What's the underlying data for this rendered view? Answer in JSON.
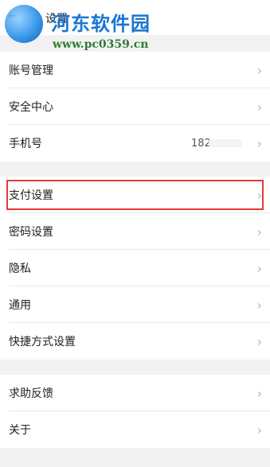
{
  "header": {
    "title": "设置"
  },
  "watermark": {
    "site_name": "河东软件园",
    "url": "www.pc0359.cn"
  },
  "groups": [
    {
      "items": [
        {
          "label": "账号管理"
        },
        {
          "label": "安全中心"
        },
        {
          "label": "手机号",
          "value": "182"
        }
      ]
    },
    {
      "items": [
        {
          "label": "支付设置"
        },
        {
          "label": "密码设置"
        },
        {
          "label": "隐私"
        },
        {
          "label": "通用"
        },
        {
          "label": "快捷方式设置"
        }
      ]
    },
    {
      "items": [
        {
          "label": "求助反馈"
        },
        {
          "label": "关于"
        }
      ]
    }
  ],
  "colors": {
    "highlight": "#e53935",
    "background": "#f2f2f2"
  },
  "icons": {
    "back": "back-arrow-icon",
    "chevron": "chevron-right-icon"
  }
}
